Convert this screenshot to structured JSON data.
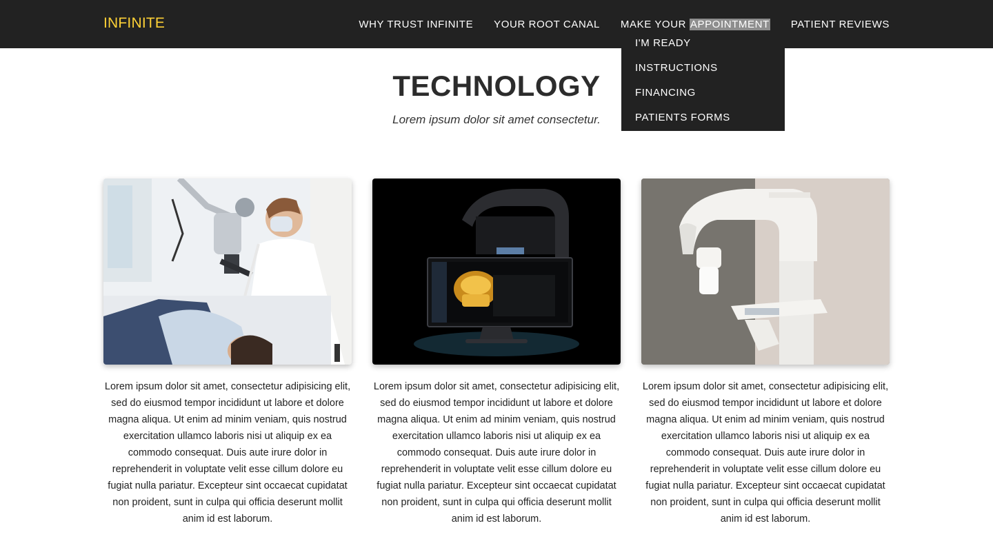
{
  "brand": "INFINITE",
  "nav": {
    "items": [
      "WHY TRUST INFINITE",
      "YOUR ROOT CANAL",
      "PATIENT REVIEWS"
    ],
    "appointment_prefix": "MAKE YOUR",
    "appointment_highlight": "APPOINTMENT"
  },
  "dropdown": {
    "items": [
      "I'M READY",
      "INSTRUCTIONS",
      "FINANCING",
      "PATIENTS FORMS"
    ]
  },
  "section": {
    "heading": "TECHNOLOGY",
    "subheading": "Lorem ipsum dolor sit amet consectetur."
  },
  "cards": [
    {
      "image": "dentist-microscope-photo",
      "text": "Lorem ipsum dolor sit amet, consectetur adipisicing elit, sed do eiusmod tempor incididunt ut labore et dolore magna aliqua. Ut enim ad minim veniam, quis nostrud exercitation ullamco laboris nisi ut aliquip ex ea commodo consequat. Duis aute irure dolor in reprehenderit in voluptate velit esse cillum dolore eu fugiat nulla pariatur. Excepteur sint occaecat cupidatat non proident, sunt in culpa qui officia deserunt mollit anim id est laborum."
    },
    {
      "image": "3d-scan-monitor-photo",
      "text": "Lorem ipsum dolor sit amet, consectetur adipisicing elit, sed do eiusmod tempor incididunt ut labore et dolore magna aliqua. Ut enim ad minim veniam, quis nostrud exercitation ullamco laboris nisi ut aliquip ex ea commodo consequat. Duis aute irure dolor in reprehenderit in voluptate velit esse cillum dolore eu fugiat nulla pariatur. Excepteur sint occaecat cupidatat non proident, sunt in culpa qui officia deserunt mollit anim id est laborum."
    },
    {
      "image": "ct-scanner-photo",
      "text": "Lorem ipsum dolor sit amet, consectetur adipisicing elit, sed do eiusmod tempor incididunt ut labore et dolore magna aliqua. Ut enim ad minim veniam, quis nostrud exercitation ullamco laboris nisi ut aliquip ex ea commodo consequat. Duis aute irure dolor in reprehenderit in voluptate velit esse cillum dolore eu fugiat nulla pariatur. Excepteur sint occaecat cupidatat non proident, sunt in culpa qui officia deserunt mollit anim id est laborum."
    }
  ],
  "colors": {
    "nav_bg": "#222222",
    "brand": "#fed136",
    "highlight": "#8e8e8e",
    "heading": "#2c2c2c"
  }
}
